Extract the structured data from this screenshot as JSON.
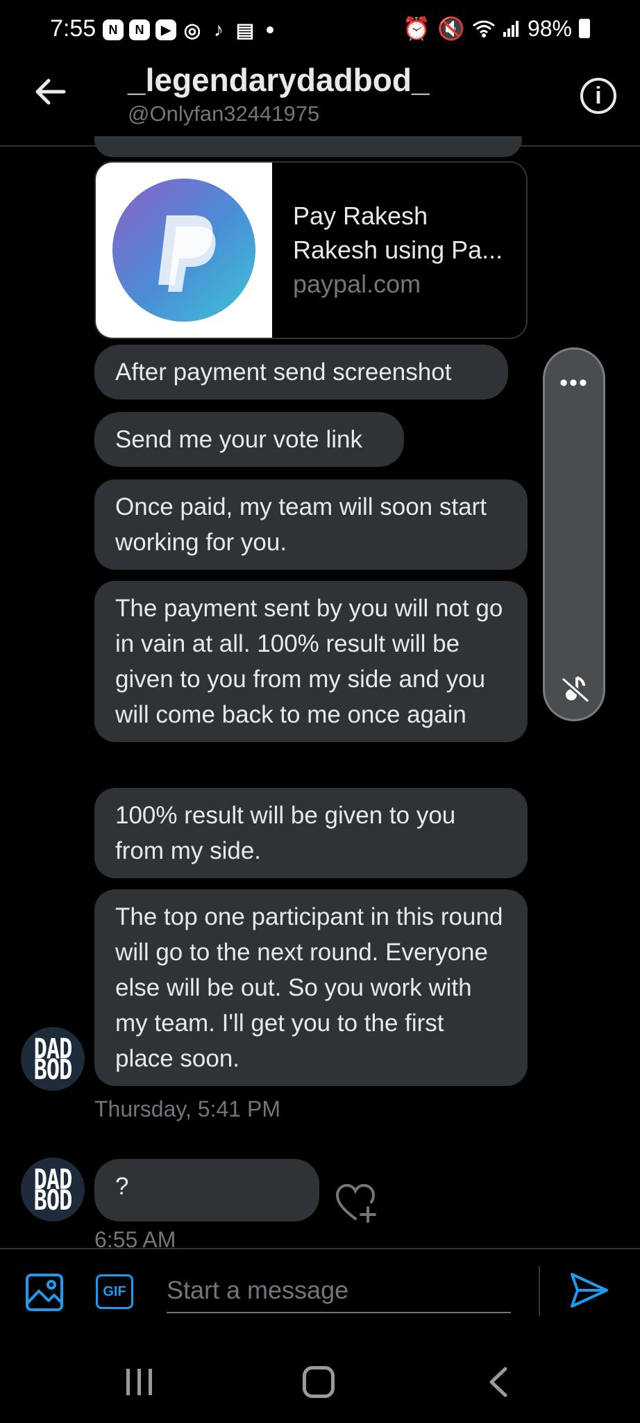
{
  "status_bar": {
    "time": "7:55",
    "battery": "98%",
    "left_icons": [
      "notification-n-icon",
      "notification-n-icon",
      "youtube-icon",
      "instagram-icon",
      "tiktok-icon",
      "news-icon"
    ],
    "right_icons": [
      "alarm-icon",
      "vibrate-mute-icon",
      "wifi-icon",
      "signal-icon",
      "battery-icon"
    ]
  },
  "header": {
    "title": "_legendarydadbod_",
    "handle": "@Onlyfan32441975"
  },
  "link_card": {
    "line1": "Pay Rakesh",
    "line2": "Rakesh using Pa...",
    "domain": "paypal.com",
    "logo_letter": "P"
  },
  "messages": [
    "After payment send screenshot",
    "Send me your vote link",
    "Once paid, my team will soon start working for you.",
    "The payment sent by you will not go in vain at all.  100% result will be given to you from my side and you will come back to me once again",
    "100% result will be given to you from my side.",
    "The top one participant in this round will go to the next round. Everyone else will be out.  So you work with my team.  I'll get you to the first place soon."
  ],
  "timestamp1": "Thursday, 5:41 PM",
  "last_message": "?",
  "timestamp2": "6:55 AM",
  "avatar": {
    "line1": "DAD",
    "line2": "BOD"
  },
  "float_control": {
    "dots": "•••"
  },
  "compose": {
    "placeholder": "Start a message",
    "gif_label": "GIF"
  },
  "colors": {
    "accent": "#1d9bf0",
    "bubble": "#2f3336",
    "background": "#000000"
  }
}
